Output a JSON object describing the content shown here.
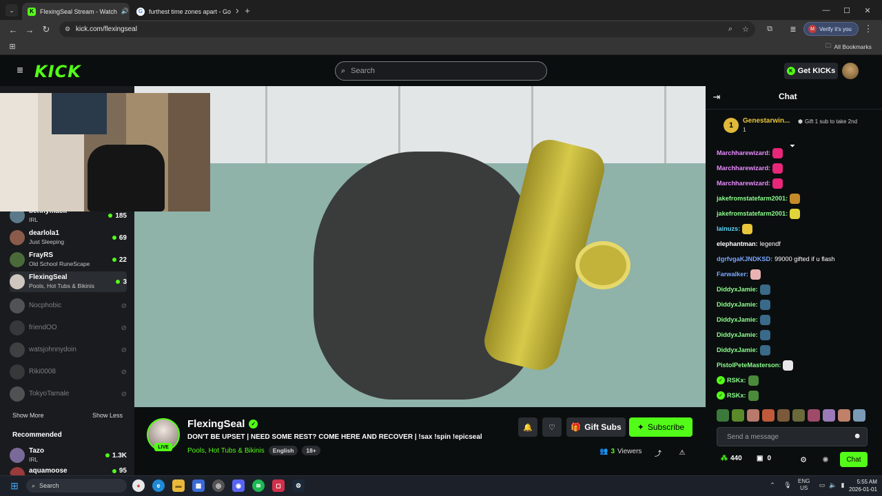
{
  "browser": {
    "tabs": [
      {
        "title": "FlexingSeal Stream - Watch",
        "active": true
      },
      {
        "title": "furthest time zones apart - Go",
        "active": false
      }
    ],
    "url": "kick.com/flexingseal",
    "verify_label": "Verify it's you",
    "verify_initial": "M",
    "all_bookmarks": "All Bookmarks"
  },
  "header": {
    "logo": "KICK",
    "search_placeholder": "Search",
    "get_kicks": "Get KICKs"
  },
  "sidebar": {
    "channels": [
      {
        "name": "bennymack",
        "category": "IRL",
        "count": "185",
        "live": true,
        "color": "#5a7a8a"
      },
      {
        "name": "dearlola1",
        "category": "Just Sleeping",
        "count": "69",
        "live": true,
        "color": "#8a5a4a"
      },
      {
        "name": "FrayRS",
        "category": "Old School RuneScape",
        "count": "22",
        "live": true,
        "color": "#4a6a3a"
      },
      {
        "name": "FlexingSeal",
        "category": "Pools, Hot Tubs & Bikinis",
        "count": "3",
        "live": true,
        "selected": true,
        "color": "#cfc6c0"
      },
      {
        "name": "Nocphobic",
        "live": false,
        "color": "#8a8a8a"
      },
      {
        "name": "friendOO",
        "live": false,
        "color": "#555"
      },
      {
        "name": "watsjohnnydoin",
        "live": false,
        "color": "#666"
      },
      {
        "name": "Riki0008",
        "live": false,
        "color": "#555"
      },
      {
        "name": "TokyoTamale",
        "live": false,
        "color": "#888"
      }
    ],
    "show_more": "Show More",
    "show_less": "Show Less",
    "recommended_title": "Recommended",
    "recommended": [
      {
        "name": "Tazo",
        "category": "IRL",
        "count": "1.3K",
        "color": "#7a6a9a"
      },
      {
        "name": "aquamoose",
        "category": "",
        "count": "95",
        "color": "#9a3a3a"
      }
    ]
  },
  "stream": {
    "name": "FlexingSeal",
    "title": "DON'T BE UPSET | NEED SOME REST? COME HERE AND RECOVER | !sax !spin !epicseal",
    "category": "Pools, Hot Tubs & Bikinis",
    "tags": [
      "English",
      "18+"
    ],
    "live_badge": "LIVE",
    "gift_subs": "Gift Subs",
    "subscribe": "Subscribe",
    "viewers_count": "3",
    "viewers_label": "Viewers"
  },
  "chat": {
    "title": "Chat",
    "top_gifter": {
      "rank": "1",
      "name": "Genestarwin...",
      "count": "1",
      "gift_prompt": "Gift 1 sub to take 2nd"
    },
    "messages": [
      {
        "user": "Marchharewizard:",
        "color": "#e98cff",
        "text": "",
        "emote": "#e8267a"
      },
      {
        "user": "Marchharewizard:",
        "color": "#e98cff",
        "text": "",
        "emote": "#e8267a"
      },
      {
        "user": "Marchharewizard:",
        "color": "#e98cff",
        "text": "",
        "emote": "#e8267a"
      },
      {
        "user": "jakefromstatefarm2001:",
        "color": "#8cff8c",
        "text": "",
        "emote": "#c58a2a"
      },
      {
        "user": "jakefromstatefarm2001:",
        "color": "#8cff8c",
        "text": "",
        "emote": "#e0d43a"
      },
      {
        "user": "lainuzs:",
        "color": "#5fd8ff",
        "text": "",
        "emote": "#e8c63a"
      },
      {
        "user": "elephantman:",
        "color": "#ffffff",
        "text": "legendf",
        "emote": ""
      },
      {
        "user": "dgrfvgaKJNDKSD:",
        "color": "#7aa6ff",
        "text": "99000 gifted if u flash",
        "emote": ""
      },
      {
        "user": "Farwalker:",
        "color": "#7aa6ff",
        "text": "",
        "emote": "#e9b3b3"
      },
      {
        "user": "DiddyxJamie:",
        "color": "#8cff8c",
        "text": "",
        "emote": "#3a6a8a"
      },
      {
        "user": "DiddyxJamie:",
        "color": "#8cff8c",
        "text": "",
        "emote": "#3a6a8a"
      },
      {
        "user": "DiddyxJamie:",
        "color": "#8cff8c",
        "text": "",
        "emote": "#3a6a8a"
      },
      {
        "user": "DiddyxJamie:",
        "color": "#8cff8c",
        "text": "",
        "emote": "#3a6a8a"
      },
      {
        "user": "DiddyxJamie:",
        "color": "#8cff8c",
        "text": "",
        "emote": "#3a6a8a"
      },
      {
        "user": "PistolPeteMasterson:",
        "color": "#8cff8c",
        "text": "",
        "emote": "#e8e8e8"
      },
      {
        "user": "RSKx:",
        "color": "#8cff8c",
        "text": "",
        "emote": "#4a8a3a",
        "badge": true
      },
      {
        "user": "RSKx:",
        "color": "#8cff8c",
        "text": "",
        "emote": "#4a8a3a",
        "badge": true
      }
    ],
    "emote_bar": [
      "#3a7a3a",
      "#5a8a2a",
      "#b87a6a",
      "#c05a3a",
      "#7a5a3a",
      "#6a6a3a",
      "#a04a6a",
      "#9a7ab8",
      "#c0806a",
      "#7a9ab8"
    ],
    "input_placeholder": "Send a message",
    "points": "440",
    "gifts": "0",
    "send_label": "Chat"
  },
  "taskbar": {
    "search_placeholder": "Search",
    "lang": "ENG",
    "region": "US",
    "time": "5:55 AM",
    "date": "2026-01-01"
  },
  "colors": {
    "accent": "#53fc18",
    "bg": "#0b0e0f",
    "panel": "#191b1f"
  }
}
